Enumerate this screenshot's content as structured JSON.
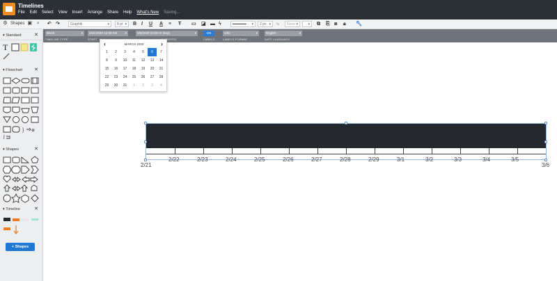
{
  "app": {
    "title": "Timelines",
    "menu": [
      "File",
      "Edit",
      "Select",
      "View",
      "Insert",
      "Arrange",
      "Share",
      "Help"
    ],
    "whats_new": "What's New",
    "saving": "Saving...",
    "logo_icon": "folder-icon",
    "brand_color": "#f28c1e"
  },
  "toolbar": {
    "font": "Graphik",
    "font_size": "8 pt",
    "line_width": "2 px",
    "arrow": "None"
  },
  "sidebar": {
    "shapes_label": "Shapes",
    "sections": [
      {
        "name": "Standard"
      },
      {
        "name": "Flowchart"
      },
      {
        "name": "Shapes"
      },
      {
        "name": "Timeline"
      }
    ],
    "add_shapes_label": "+ Shapes"
  },
  "properties": {
    "timeline_type": {
      "value": "Block",
      "caption": "TIMELINE TYPE"
    },
    "start": {
      "value": "2/21/2020 12:00 AM",
      "caption": "START"
    },
    "end": {
      "value": "3/6/2020 12:00 AM",
      "caption": ""
    },
    "markers": {
      "value": "Days",
      "caption": "MARKERS"
    },
    "labels": {
      "value": "ON",
      "caption": "LABELS"
    },
    "labels_format": {
      "value": "1/31",
      "caption": "LABELS FORMAT"
    },
    "date_language": {
      "value": "English",
      "caption": "DATE LANGUAGE"
    },
    "accent_color": "#2a7bd5"
  },
  "datepicker": {
    "month": "MARCH 2020",
    "prev": "‹",
    "next": "›",
    "weeks": [
      [
        "1",
        "2",
        "3",
        "4",
        "5",
        "6",
        "7"
      ],
      [
        "8",
        "9",
        "10",
        "11",
        "12",
        "13",
        "14"
      ],
      [
        "15",
        "16",
        "17",
        "18",
        "19",
        "20",
        "21"
      ],
      [
        "22",
        "23",
        "24",
        "25",
        "26",
        "27",
        "28"
      ],
      [
        "29",
        "30",
        "31",
        "1",
        "2",
        "3",
        "4"
      ]
    ],
    "selected": "6"
  },
  "timeline": {
    "labels": [
      "2/21",
      "2/22",
      "2/23",
      "2/24",
      "2/25",
      "2/26",
      "2/27",
      "2/28",
      "2/29",
      "3/1",
      "3/2",
      "3/3",
      "3/4",
      "3/5",
      "3/6"
    ],
    "bar_color": "#24282e"
  }
}
